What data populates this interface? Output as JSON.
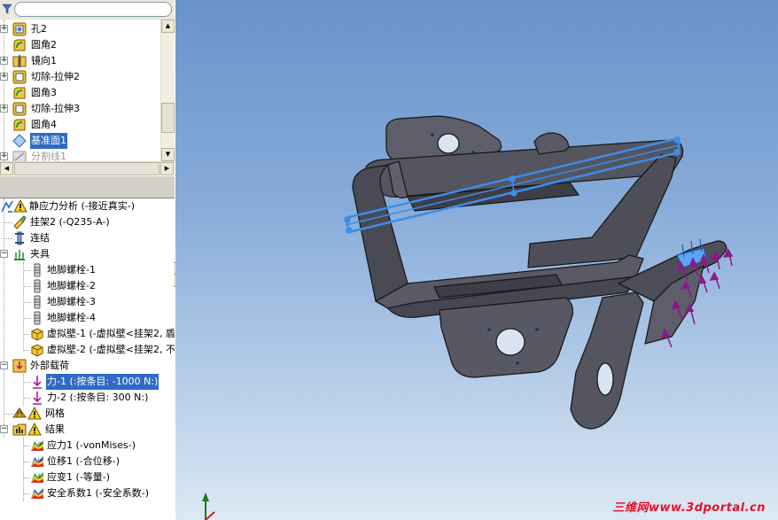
{
  "filter": {
    "placeholder": "",
    "value": ""
  },
  "tree_top": {
    "items": [
      {
        "label": "孔2",
        "icon": "hole-feature-icon"
      },
      {
        "label": "圆角2",
        "icon": "fillet-feature-icon"
      },
      {
        "label": "镜向1",
        "icon": "mirror-feature-icon"
      },
      {
        "label": "切除-拉伸2",
        "icon": "cut-extrude-feature-icon"
      },
      {
        "label": "圆角3",
        "icon": "fillet-feature-icon"
      },
      {
        "label": "切除-拉伸3",
        "icon": "cut-extrude-feature-icon"
      },
      {
        "label": "圆角4",
        "icon": "fillet-feature-icon"
      },
      {
        "label": "基准面1",
        "icon": "plane-icon",
        "selected": true
      },
      {
        "label": "分割线1",
        "icon": "split-line-icon",
        "dimmed": true
      }
    ]
  },
  "tree_bottom": {
    "study": "静应力分析 (-接近真实-)",
    "part": "挂架2 (-Q235-A-)",
    "connections": "连结",
    "fixtures": {
      "label": "夹具",
      "items": [
        "地脚螺栓-1",
        "地脚螺栓-2",
        "地脚螺栓-3",
        "地脚螺栓-4",
        "虚拟壁-1 (-虚拟壁<挂架2, 盾",
        "虚拟壁-2 (-虚拟壁<挂架2, 不"
      ]
    },
    "external_loads": {
      "label": "外部载荷",
      "items": [
        {
          "label": "力-1 (:按条目: -1000 N:)",
          "selected": true
        },
        {
          "label": "力-2 (:按条目: 300 N:)",
          "selected": false
        }
      ]
    },
    "mesh": "网格",
    "results": {
      "label": "结果",
      "items": [
        "应力1 (-vonMises-)",
        "位移1 (-合位移-)",
        "应变1 (-等量-)",
        "安全系数1 (-安全系数-)"
      ]
    }
  },
  "watermark": "三维网www.3dportal.cn",
  "colors": {
    "selection": "#316ac5",
    "model_face": "#5f5f6b",
    "model_edge": "#1a1a1a",
    "plane_outline": "#3a8ee8",
    "load_arrow": "#8a1a8a",
    "viewport_top": "#6a93c9",
    "viewport_bottom": "#dce8f4",
    "watermark": "#e8102a"
  }
}
